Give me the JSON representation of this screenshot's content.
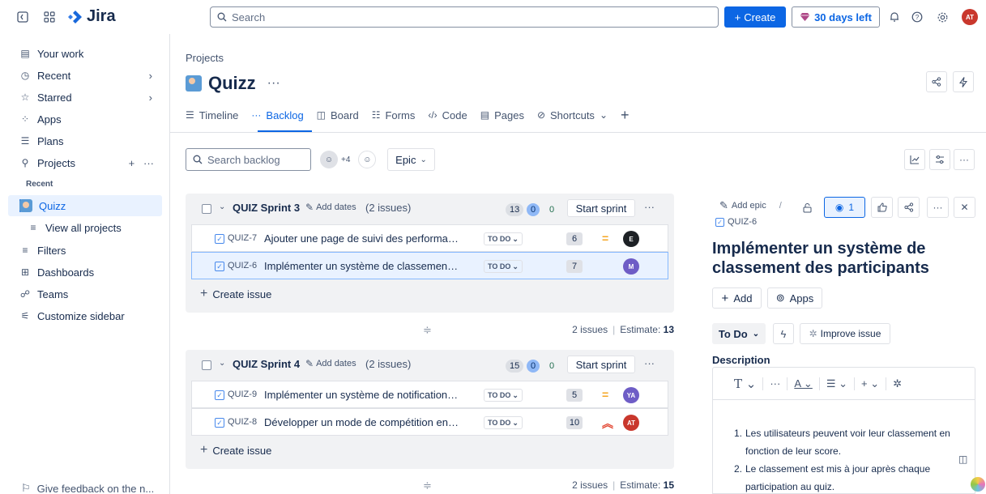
{
  "topbar": {
    "app_name": "Jira",
    "search_placeholder": "Search",
    "create_label": "Create",
    "trial_label": "30 days left",
    "user_initials": "AT"
  },
  "sidebar": {
    "items": [
      {
        "label": "Your work",
        "icon": "inbox-icon"
      },
      {
        "label": "Recent",
        "icon": "clock-icon"
      },
      {
        "label": "Starred",
        "icon": "star-icon"
      },
      {
        "label": "Apps",
        "icon": "apps-icon"
      },
      {
        "label": "Plans",
        "icon": "plans-icon"
      },
      {
        "label": "Projects",
        "icon": "rocket-icon"
      }
    ],
    "recent_heading": "Recent",
    "active_project": "Quizz",
    "view_all": "View all projects",
    "bottom_items": [
      {
        "label": "Filters",
        "icon": "filter-icon"
      },
      {
        "label": "Dashboards",
        "icon": "dashboard-icon"
      },
      {
        "label": "Teams",
        "icon": "teams-icon"
      },
      {
        "label": "Customize sidebar",
        "icon": "customize-icon"
      }
    ],
    "feedback": "Give feedback on the n..."
  },
  "header": {
    "breadcrumb": "Projects",
    "title": "Quizz",
    "tabs": [
      {
        "label": "Timeline",
        "icon": "timeline-icon"
      },
      {
        "label": "Backlog",
        "icon": "backlog-icon"
      },
      {
        "label": "Board",
        "icon": "board-icon"
      },
      {
        "label": "Forms",
        "icon": "forms-icon"
      },
      {
        "label": "Code",
        "icon": "code-icon"
      },
      {
        "label": "Pages",
        "icon": "pages-icon"
      },
      {
        "label": "Shortcuts",
        "icon": "link-icon"
      }
    ]
  },
  "backlog": {
    "search_placeholder": "Search backlog",
    "avatar_more": "+4",
    "epic_label": "Epic",
    "add_dates": "Add dates",
    "start_sprint": "Start sprint",
    "create_issue": "Create issue",
    "sprints": [
      {
        "name": "QUIZ Sprint 3",
        "count": "(2 issues)",
        "points_todo": "13",
        "points_progress": "0",
        "points_done": "0",
        "summary_issues": "2 issues",
        "summary_estimate_label": "Estimate:",
        "summary_estimate": "13",
        "issues": [
          {
            "key": "QUIZ-7",
            "summary": "Ajouter une page de suivi des performan...",
            "status": "TO DO",
            "estimate": "6",
            "priority": "medium",
            "assignee": "E",
            "assignee_color": "#1d2125"
          },
          {
            "key": "QUIZ-6",
            "summary": "Implémenter un système de classement ...",
            "status": "TO DO",
            "estimate": "7",
            "priority": "none",
            "assignee": "M",
            "assignee_color": "#6e5dc6"
          }
        ]
      },
      {
        "name": "QUIZ Sprint 4",
        "count": "(2 issues)",
        "points_todo": "15",
        "points_progress": "0",
        "points_done": "0",
        "summary_issues": "2 issues",
        "summary_estimate_label": "Estimate:",
        "summary_estimate": "15",
        "issues": [
          {
            "key": "QUIZ-9",
            "summary": "Implémenter un système de notifications...",
            "status": "TO DO",
            "estimate": "5",
            "priority": "medium",
            "assignee": "YA",
            "assignee_color": "#6e5dc6"
          },
          {
            "key": "QUIZ-8",
            "summary": "Développer un mode de compétition en t...",
            "status": "TO DO",
            "estimate": "10",
            "priority": "high",
            "assignee": "AT",
            "assignee_color": "#c9372c"
          }
        ]
      }
    ]
  },
  "detail": {
    "add_epic": "Add epic",
    "watch_count": "1",
    "key": "QUIZ-6",
    "title": "Implémenter un système de classement des participants",
    "add_label": "Add",
    "apps_label": "Apps",
    "status": "To Do",
    "improve_label": "Improve issue",
    "description_label": "Description",
    "description_items": [
      "Les utilisateurs peuvent voir leur classement en fonction de leur score.",
      "Le classement est mis à jour après chaque participation au quiz."
    ]
  },
  "colors": {
    "accent": "#0c66e4",
    "priority_medium": "#f5a623",
    "priority_high": "#e34935"
  }
}
